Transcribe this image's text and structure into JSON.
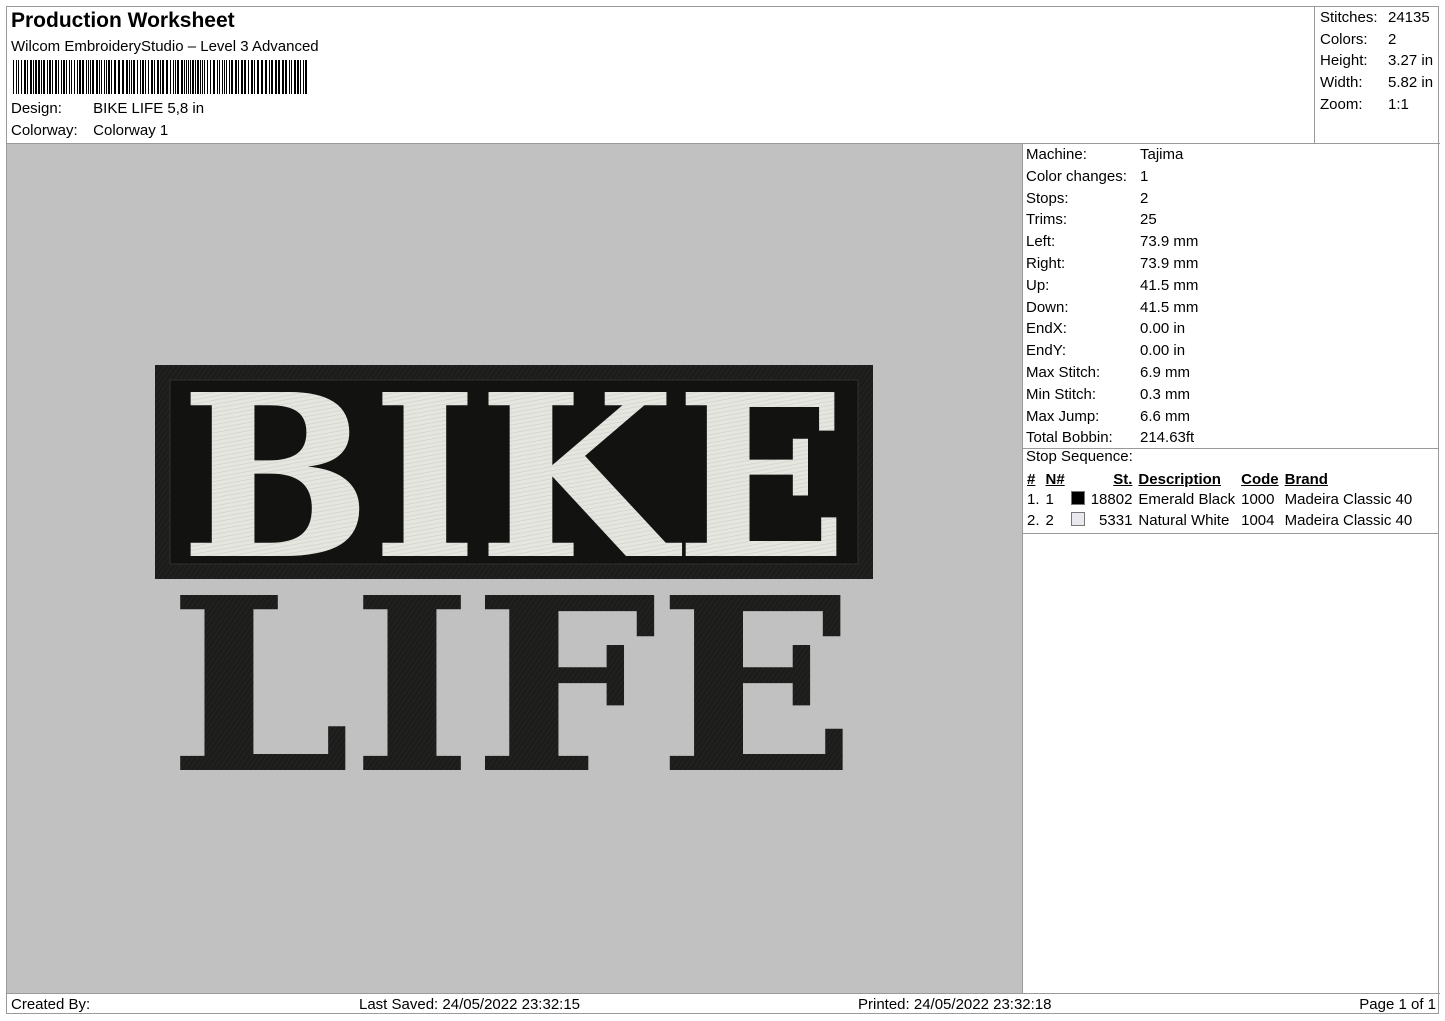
{
  "header": {
    "title": "Production Worksheet",
    "software": "Wilcom EmbroideryStudio – Level 3 Advanced",
    "design_label": "Design:",
    "design_value": "BIKE LIFE 5,8 in",
    "colorway_label": "Colorway:",
    "colorway_value": "Colorway 1"
  },
  "summary": {
    "stitches_label": "Stitches:",
    "stitches": "24135",
    "colors_label": "Colors:",
    "colors": "2",
    "height_label": "Height:",
    "height": "3.27 in",
    "width_label": "Width:",
    "width": "5.82 in",
    "zoom_label": "Zoom:",
    "zoom": "1:1"
  },
  "design": {
    "line1": "BIKE",
    "line2": "LIFE",
    "thread_dark": "#1c1d1b",
    "thread_light": "#e6e6e0",
    "background": "#c1c1c1"
  },
  "machine_info": [
    {
      "label": "Machine:",
      "value": "Tajima"
    },
    {
      "label": "Color changes:",
      "value": "1"
    },
    {
      "label": "Stops:",
      "value": "2"
    },
    {
      "label": "Trims:",
      "value": "25"
    },
    {
      "label": "Left:",
      "value": "73.9 mm"
    },
    {
      "label": "Right:",
      "value": "73.9 mm"
    },
    {
      "label": "Up:",
      "value": "41.5 mm"
    },
    {
      "label": "Down:",
      "value": "41.5 mm"
    },
    {
      "label": "EndX:",
      "value": "0.00 in"
    },
    {
      "label": "EndY:",
      "value": "0.00 in"
    },
    {
      "label": "Max Stitch:",
      "value": "6.9 mm"
    },
    {
      "label": "Min Stitch:",
      "value": "0.3 mm"
    },
    {
      "label": "Max Jump:",
      "value": "6.6 mm"
    },
    {
      "label": "Total Bobbin:",
      "value": "214.63ft"
    }
  ],
  "stop_sequence": {
    "title": "Stop Sequence:",
    "columns": [
      "#",
      "N#",
      "St.",
      "Description",
      "Code",
      "Brand"
    ],
    "rows": [
      {
        "num": "1.",
        "n": "1",
        "color": "#000000",
        "stitches": "18802",
        "description": "Emerald Black",
        "code": "1000",
        "brand": "Madeira Classic 40"
      },
      {
        "num": "2.",
        "n": "2",
        "color": "#e8e8ee",
        "stitches": "5331",
        "description": "Natural White",
        "code": "1004",
        "brand": "Madeira Classic 40"
      }
    ]
  },
  "footer": {
    "created_by": "Created By:",
    "last_saved": "Last Saved: 24/05/2022 23:32:15",
    "printed": "Printed: 24/05/2022 23:32:18",
    "page": "Page 1 of 1"
  }
}
